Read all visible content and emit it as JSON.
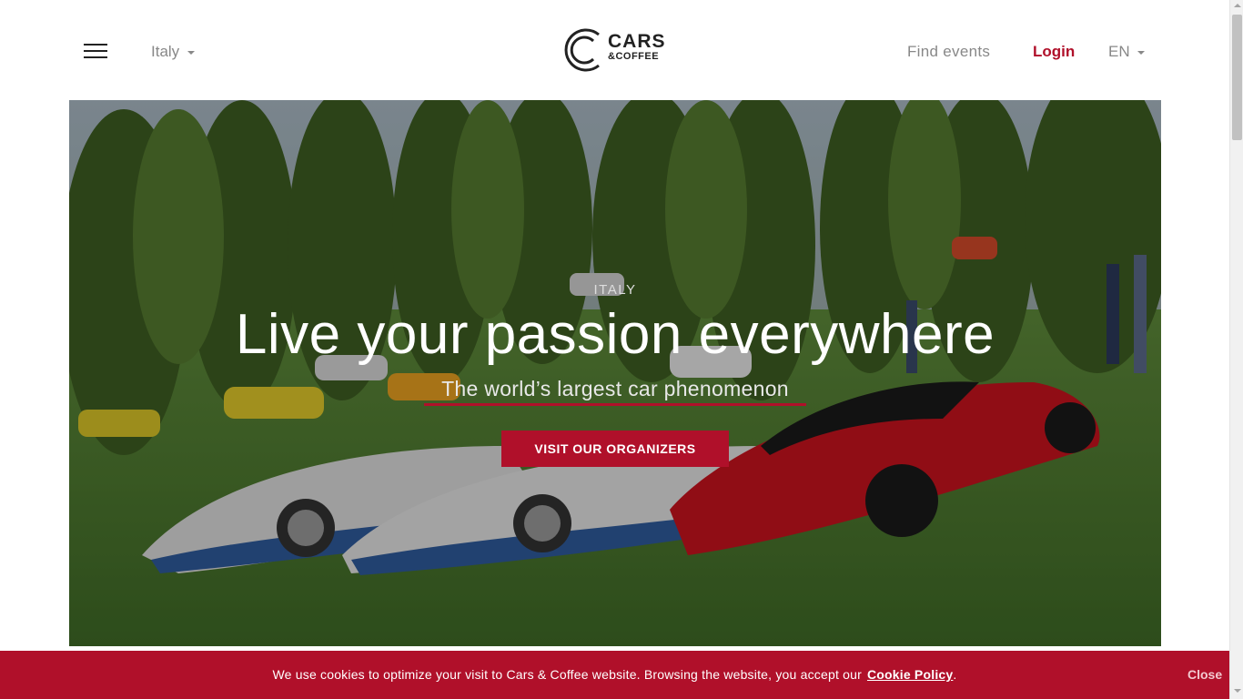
{
  "header": {
    "country": "Italy",
    "logo": {
      "line1": "CARS",
      "line2": "&COFFEE"
    },
    "nav": {
      "find_events": "Find events",
      "login": "Login",
      "language": "EN"
    }
  },
  "hero": {
    "country_label": "ITALY",
    "title": "Live your passion everywhere",
    "subtitle": "The world’s largest car phenomenon",
    "button_label": "VISIT OUR ORGANIZERS"
  },
  "cookie_bar": {
    "text": "We use cookies to optimize your visit to Cars & Coffee website. Browsing the website, you accept our",
    "link_label": "Cookie Policy",
    "trailing": ".",
    "close_label": "Close"
  },
  "colors": {
    "accent": "#b0102a",
    "muted_text": "#888888"
  }
}
